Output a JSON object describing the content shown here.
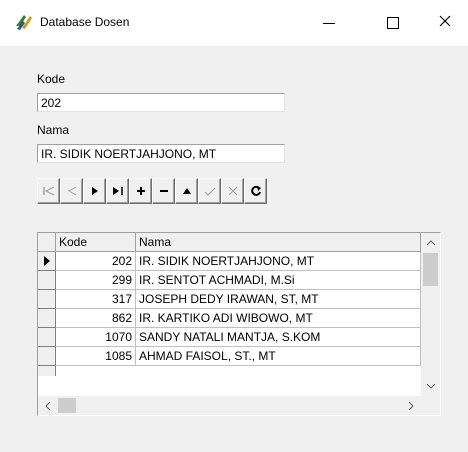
{
  "window": {
    "title": "Database Dosen",
    "minimize_icon": "minimize-icon",
    "maximize_icon": "maximize-icon",
    "close_icon": "close-icon"
  },
  "form": {
    "kode_label": "Kode",
    "kode_value": "202",
    "nama_label": "Nama",
    "nama_value": "IR. SIDIK NOERTJAHJONO, MT"
  },
  "navigator": {
    "buttons": [
      {
        "name": "first",
        "icon": "first-record-icon",
        "enabled": false
      },
      {
        "name": "prior",
        "icon": "prior-record-icon",
        "enabled": false
      },
      {
        "name": "next",
        "icon": "next-record-icon",
        "enabled": true
      },
      {
        "name": "last",
        "icon": "last-record-icon",
        "enabled": true
      },
      {
        "name": "insert",
        "icon": "plus-icon",
        "enabled": true
      },
      {
        "name": "delete",
        "icon": "minus-icon",
        "enabled": true
      },
      {
        "name": "edit",
        "icon": "edit-triangle-icon",
        "enabled": true
      },
      {
        "name": "post",
        "icon": "check-icon",
        "enabled": false
      },
      {
        "name": "cancel",
        "icon": "cancel-x-icon",
        "enabled": false
      },
      {
        "name": "refresh",
        "icon": "refresh-icon",
        "enabled": true
      }
    ]
  },
  "grid": {
    "columns": [
      "Kode",
      "Nama"
    ],
    "rows": [
      {
        "kode": "202",
        "nama": "IR. SIDIK NOERTJAHJONO, MT",
        "current": true
      },
      {
        "kode": "299",
        "nama": "IR. SENTOT ACHMADI, M.Si",
        "current": false
      },
      {
        "kode": "317",
        "nama": "JOSEPH DEDY IRAWAN, ST, MT",
        "current": false
      },
      {
        "kode": "862",
        "nama": "IR. KARTIKO ADI WIBOWO, MT",
        "current": false
      },
      {
        "kode": "1070",
        "nama": "SANDY NATALI MANTJA, S.KOM",
        "current": false
      },
      {
        "kode": "1085",
        "nama": "AHMAD FAISOL, ST., MT",
        "current": false
      }
    ]
  },
  "colors": {
    "window_bg": "#f0f0f0",
    "titlebar_bg": "#ffffff",
    "disabled_icon": "#a0a0a0"
  }
}
